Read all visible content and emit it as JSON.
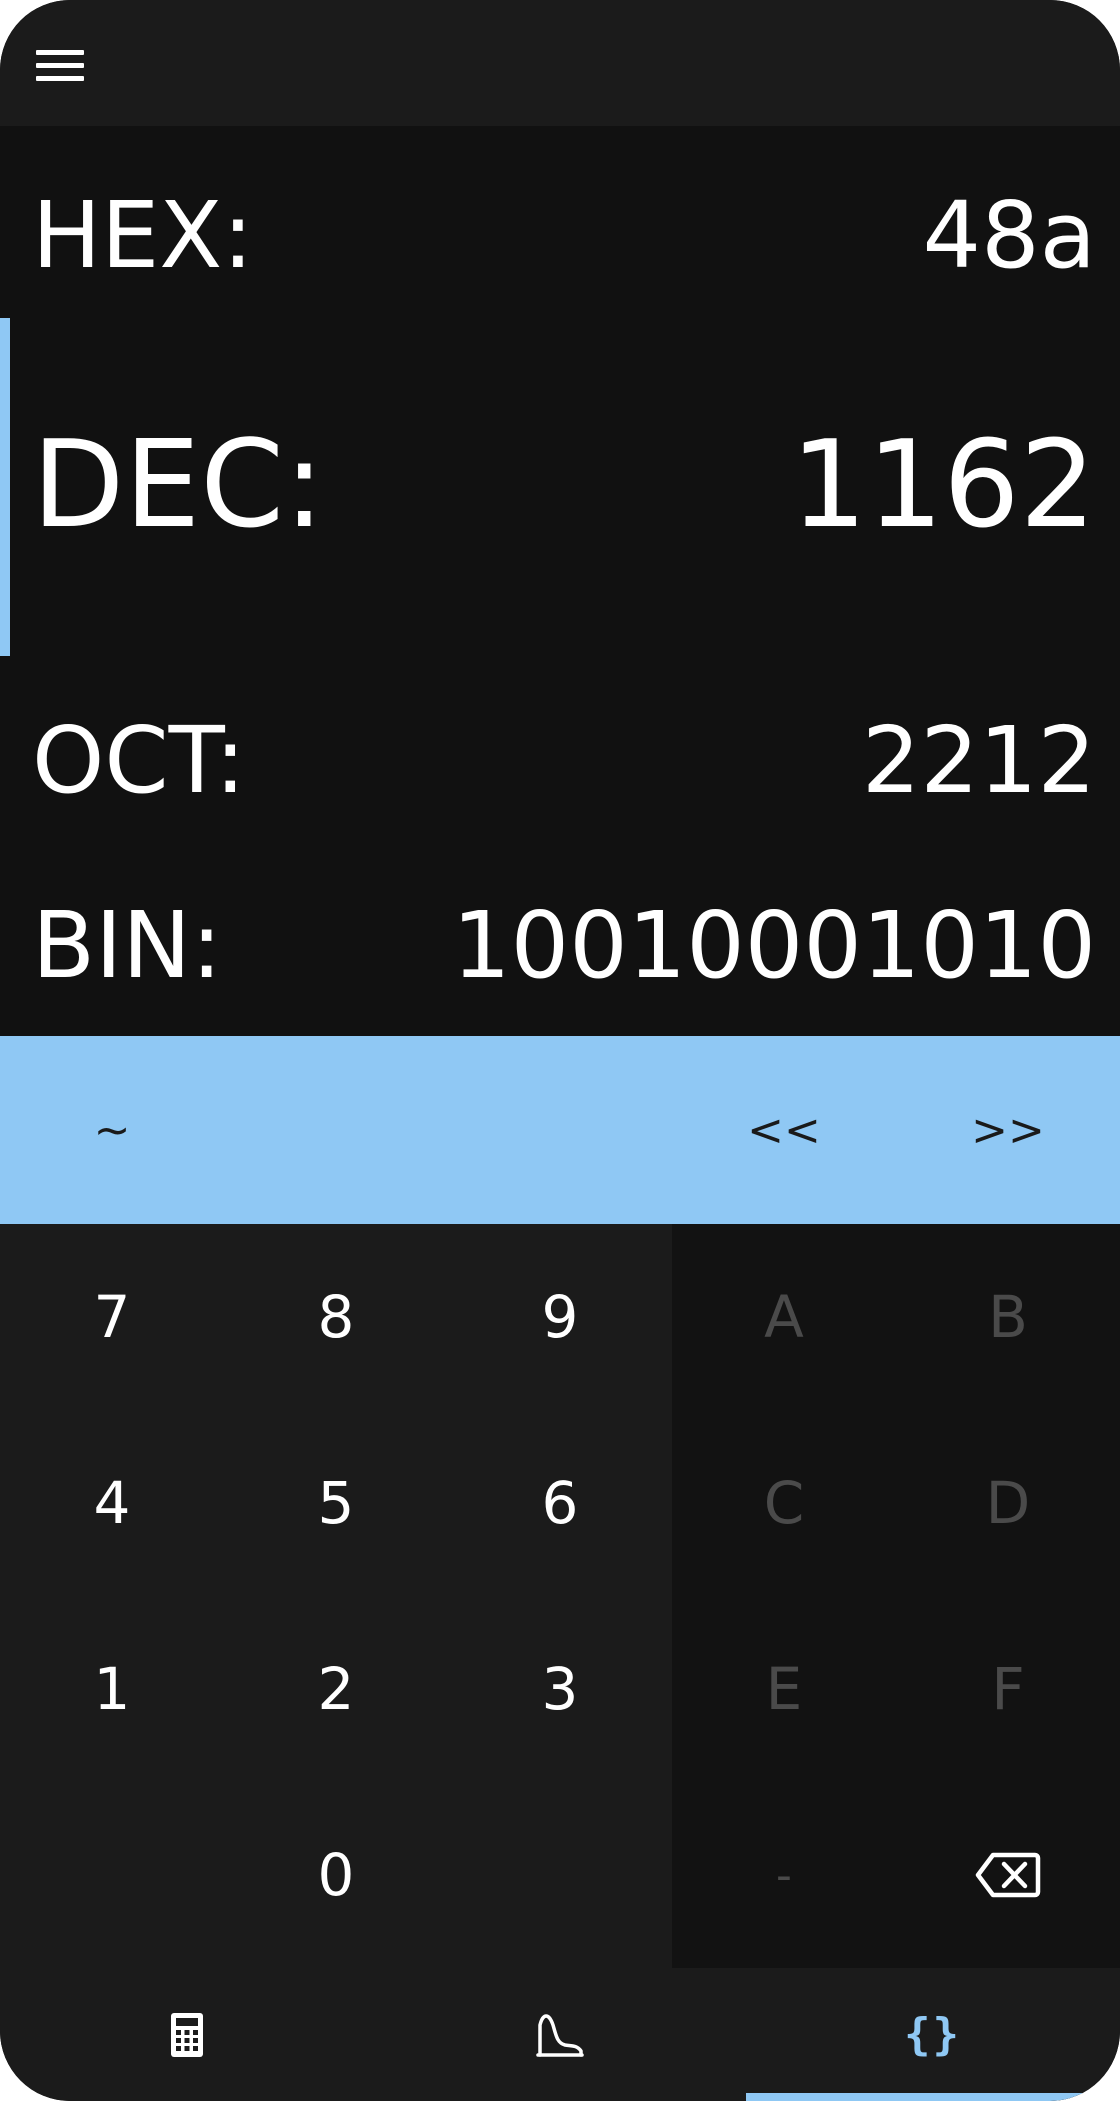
{
  "topbar": {
    "menu_icon": "hamburger-menu-icon"
  },
  "display": {
    "hex": {
      "label": "HEX:",
      "value": "48a"
    },
    "dec": {
      "label": "DEC:",
      "value": "1162"
    },
    "oct": {
      "label": "OCT:",
      "value": "2212"
    },
    "bin": {
      "label": "BIN:",
      "value": "10010001010"
    },
    "selected": "dec"
  },
  "ops": {
    "not": "~",
    "shift_left": "<<",
    "shift_right": ">>"
  },
  "keys": {
    "k7": "7",
    "k8": "8",
    "k9": "9",
    "k4": "4",
    "k5": "5",
    "k6": "6",
    "k1": "1",
    "k2": "2",
    "k3": "3",
    "k0": "0",
    "kA": "A",
    "kB": "B",
    "kC": "C",
    "kD": "D",
    "kE": "E",
    "kF": "F",
    "minus": "-",
    "backspace_icon": "backspace-icon"
  },
  "nav": {
    "tabs": [
      {
        "icon": "calculator-icon"
      },
      {
        "icon": "graph-icon"
      },
      {
        "icon": "braces-icon",
        "label": "{}"
      }
    ],
    "active_tab": 2
  },
  "colors": {
    "accent": "#8fc8f4",
    "background": "#111111",
    "panel": "#1b1b1b",
    "disabled_text": "#4a4a4a"
  }
}
